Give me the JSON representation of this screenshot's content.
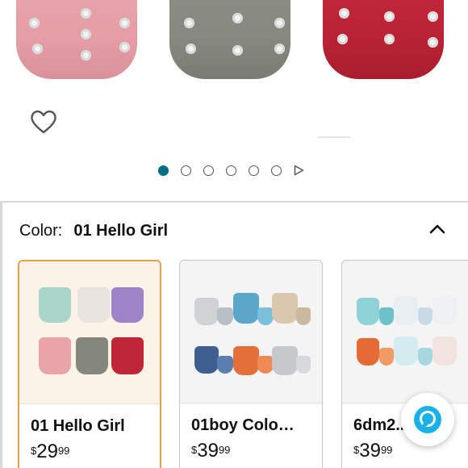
{
  "carousel": {
    "dots_total": 6,
    "active_index": 0,
    "has_video": true
  },
  "variation": {
    "label": "Color:",
    "selected_value": "01 Hello Girl"
  },
  "swatches": [
    {
      "name": "01 Hello Girl",
      "price_symbol": "$",
      "price_whole": "29",
      "price_fraction": "99",
      "selected": true
    },
    {
      "name": "01boy Colo…",
      "price_symbol": "$",
      "price_whole": "39",
      "price_fraction": "99",
      "selected": false
    },
    {
      "name": "6dm2...",
      "price_symbol": "$",
      "price_whole": "39",
      "price_fraction": "99",
      "selected": false
    }
  ],
  "icons": {
    "wishlist": "heart-outline-icon",
    "collapse": "chevron-up-icon",
    "video": "play-triangle-icon",
    "assistant": "alexa-ring-icon"
  },
  "colors": {
    "accent_teal": "#007185",
    "selected_border": "#e7a04b",
    "alexa_cyan": "#1ab0e8"
  }
}
